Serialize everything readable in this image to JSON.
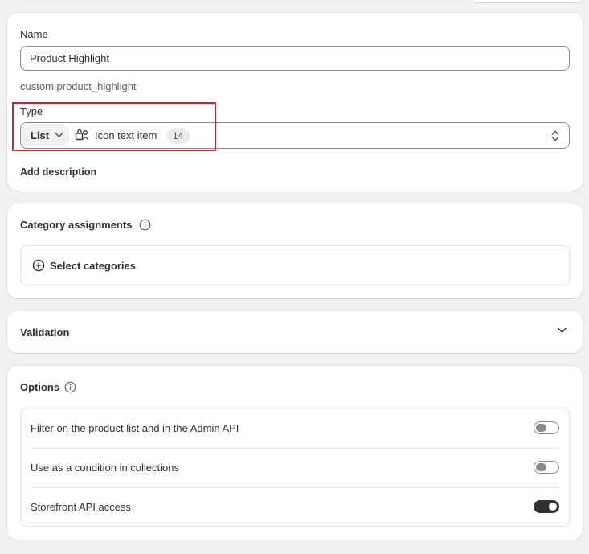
{
  "definition": {
    "name_label": "Name",
    "name_value": "Product Highlight",
    "namespace_key": "custom.product_highlight",
    "type_label": "Type",
    "type_list_label": "List",
    "type_name": "Icon text item",
    "type_count": "14",
    "add_description": "Add description"
  },
  "categories": {
    "title": "Category assignments",
    "select_label": "Select categories"
  },
  "validation": {
    "title": "Validation"
  },
  "options": {
    "title": "Options",
    "items": [
      {
        "label": "Filter on the product list and in the Admin API",
        "enabled": false
      },
      {
        "label": "Use as a condition in collections",
        "enabled": false
      },
      {
        "label": "Storefront API access",
        "enabled": true
      }
    ]
  },
  "icons": {
    "list_dropdown": "chevron-down-icon",
    "type": "metaobject-icon",
    "type_select": "select-updown-icon",
    "info": "info-icon",
    "add": "plus-circle-icon",
    "validation_toggle": "chevron-down-icon"
  },
  "colors": {
    "highlight": "#e01b24",
    "toggle_on": "#303030",
    "toggle_off": "#8a8a8a"
  }
}
